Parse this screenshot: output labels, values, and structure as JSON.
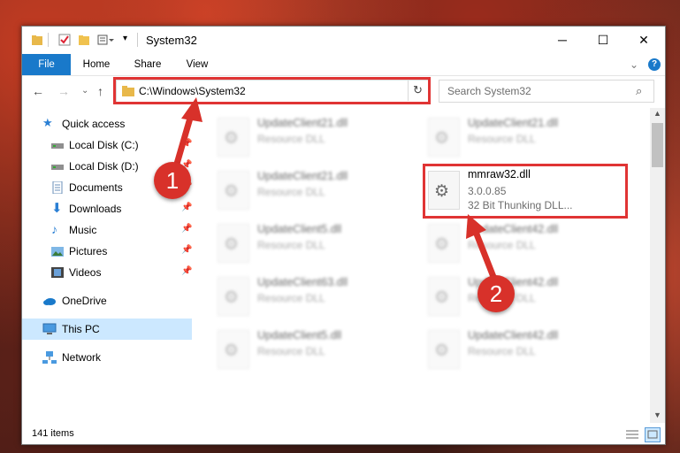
{
  "window": {
    "title": "System32"
  },
  "ribbon": {
    "tabs": [
      "File",
      "Home",
      "Share",
      "View"
    ]
  },
  "address_bar": {
    "path": "C:\\Windows\\System32"
  },
  "search": {
    "placeholder": "Search System32"
  },
  "sidebar": {
    "items": [
      {
        "label": "Quick access",
        "icon": "star-icon",
        "pinned": false
      },
      {
        "label": "Local Disk (C:)",
        "icon": "drive-icon",
        "pinned": true
      },
      {
        "label": "Local Disk (D:)",
        "icon": "drive-icon",
        "pinned": true
      },
      {
        "label": "Documents",
        "icon": "documents-icon",
        "pinned": true
      },
      {
        "label": "Downloads",
        "icon": "download-arrow-icon",
        "pinned": true
      },
      {
        "label": "Music",
        "icon": "music-note-icon",
        "pinned": true
      },
      {
        "label": "Pictures",
        "icon": "pictures-icon",
        "pinned": true
      },
      {
        "label": "Videos",
        "icon": "film-icon",
        "pinned": true
      },
      {
        "label": "OneDrive",
        "icon": "cloud-icon",
        "pinned": false
      },
      {
        "label": "This PC",
        "icon": "computer-icon",
        "pinned": false,
        "selected": true
      },
      {
        "label": "Network",
        "icon": "network-icon",
        "pinned": false
      }
    ]
  },
  "files": {
    "left_column": [
      {
        "name": "UpdateClient21.dll",
        "desc": "Resource DLL"
      },
      {
        "name": "UpdateClient21.dll",
        "desc": "Resource DLL"
      },
      {
        "name": "UpdateClient5.dll",
        "desc": "Resource DLL"
      },
      {
        "name": "UpdateClient63.dll",
        "desc": "Resource DLL"
      },
      {
        "name": "UpdateClient5.dll",
        "desc": "Resource DLL"
      }
    ],
    "right_column": [
      {
        "name": "UpdateClient21.dll",
        "desc": "Resource DLL"
      },
      {
        "name": "mmraw32.dll",
        "version": "3.0.0.85",
        "desc": "32 Bit Thunking DLL...",
        "highlighted": true
      },
      {
        "name": "UpdateClient42.dll",
        "desc": "Resource DLL"
      },
      {
        "name": "UpdateClient42.dll",
        "desc": "Resource DLL"
      },
      {
        "name": "UpdateClient42.dll",
        "desc": "Resource DLL"
      }
    ]
  },
  "status": {
    "item_count": "141 items"
  },
  "callouts": [
    "1",
    "2"
  ],
  "colors": {
    "accent": "#1979ca",
    "highlight_border": "#e03434",
    "callout": "#d8312a",
    "selection": "#cce8ff"
  }
}
